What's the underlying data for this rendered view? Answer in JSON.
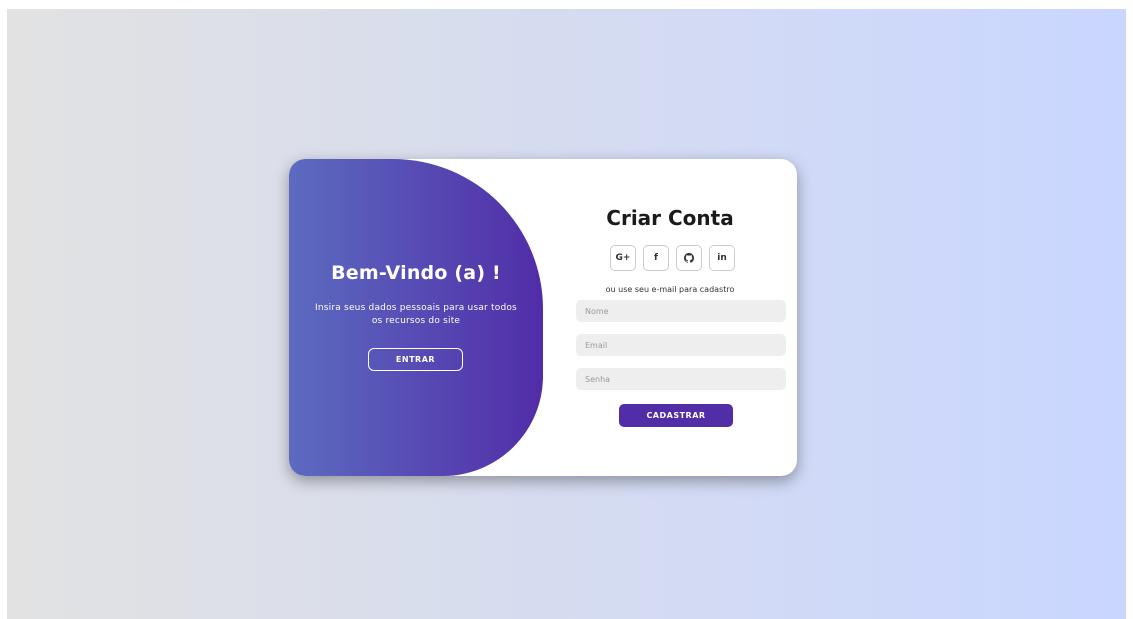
{
  "colors": {
    "background_start": "#e2e2e2",
    "background_end": "#c9d6ff",
    "panel_start": "#5c6bc0",
    "panel_end": "#512da8",
    "primary_button": "#512da8",
    "input_background": "#eeeeee"
  },
  "welcome_panel": {
    "title": "Bem-Vindo (a) !",
    "text": "Insira seus dados pessoais para usar todos os recursos do site",
    "button_label": "ENTRAR"
  },
  "signup_form": {
    "title": "Criar Conta",
    "socials": [
      {
        "icon": "google-plus-icon",
        "label": "G+"
      },
      {
        "icon": "facebook-icon",
        "label": "f"
      },
      {
        "icon": "github-icon",
        "label": ""
      },
      {
        "icon": "linkedin-icon",
        "label": "in"
      }
    ],
    "subtitle": "ou use seu e-mail para cadastro",
    "name_field": {
      "placeholder": "Nome",
      "value": ""
    },
    "email_field": {
      "placeholder": "Email",
      "value": ""
    },
    "password_field": {
      "placeholder": "Senha",
      "value": ""
    },
    "submit_label": "CADASTRAR"
  }
}
